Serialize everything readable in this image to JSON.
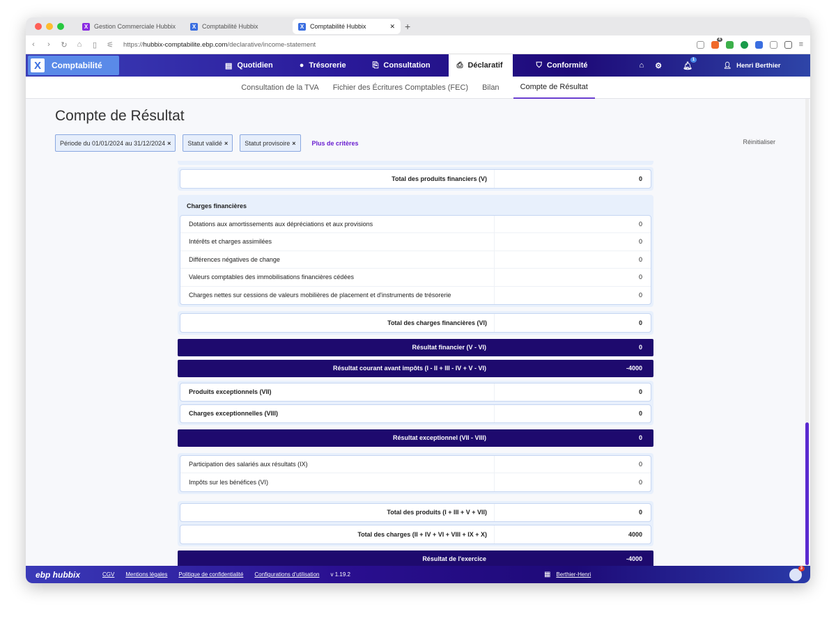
{
  "browser": {
    "tabs": [
      {
        "label": "Gestion Commerciale Hubbix",
        "color": "#8a2be2"
      },
      {
        "label": "Comptabilité Hubbix",
        "color": "#3a6ee0"
      },
      {
        "label": "Comptabilité Hubbix",
        "color": "#3a6ee0",
        "active": true
      }
    ],
    "url_prefix": "https://",
    "url_host": "hubbix-comptabilite.ebp.com",
    "url_path": "/declarative/income-statement",
    "shield_badge": "4"
  },
  "app": {
    "brand": "Comptabilité",
    "menu": [
      {
        "label": "Quotidien",
        "icon": "▤"
      },
      {
        "label": "Trésorerie",
        "icon": "●"
      },
      {
        "label": "Consultation",
        "icon": "⎘"
      },
      {
        "label": "Déclaratif",
        "icon": "⎙",
        "active": true
      },
      {
        "label": "Conformité",
        "icon": "⛉"
      }
    ],
    "notifications": "1",
    "user": "Henri Berthier"
  },
  "subnav": [
    "Consultation de la TVA",
    "Fichier des Écritures Comptables (FEC)",
    "Bilan",
    "Compte de Résultat"
  ],
  "page": {
    "title": "Compte de Résultat",
    "filters": [
      "Période du 01/01/2024 au 31/12/2024",
      "Statut validé",
      "Statut provisoire"
    ],
    "more": "Plus de critères",
    "reset": "Réinitialiser"
  },
  "report": {
    "total_produits_fin": {
      "label": "Total des produits financiers (V)",
      "value": "0"
    },
    "charges_fin": {
      "header": "Charges financières",
      "rows": [
        {
          "label": "Dotations aux amortissements aux dépréciations et aux provisions",
          "value": "0"
        },
        {
          "label": "Intérêts et charges assimilées",
          "value": "0"
        },
        {
          "label": "Différences négatives de change",
          "value": "0"
        },
        {
          "label": "Valeurs comptables des immobilisations financières cédées",
          "value": "0"
        },
        {
          "label": "Charges nettes sur cessions de valeurs mobilières de placement et d'instruments de trésorerie",
          "value": "0"
        }
      ]
    },
    "total_charges_fin": {
      "label": "Total des charges financières (VI)",
      "value": "0"
    },
    "resultat_fin": {
      "label": "Résultat financier (V - VI)",
      "value": "0"
    },
    "resultat_courant": {
      "label": "Résultat courant avant impôts (I - II + III - IV + V - VI)",
      "value": "-4000"
    },
    "exceptionnels": [
      {
        "label": "Produits exceptionnels (VII)",
        "value": "0"
      },
      {
        "label": "Charges exceptionnelles (VIII)",
        "value": "0"
      }
    ],
    "resultat_exc": {
      "label": "Résultat exceptionnel (VII - VIII)",
      "value": "0"
    },
    "participation": [
      {
        "label": "Participation des salariés aux résultats (IX)",
        "value": "0"
      },
      {
        "label": "Impôts sur les bénéfices (VI)",
        "value": "0"
      }
    ],
    "totaux": [
      {
        "label": "Total des produits (I + III + V + VII)",
        "value": "0"
      },
      {
        "label": "Total des charges (II + IV + VI + VIII + IX + X)",
        "value": "4000"
      }
    ],
    "resultat_exercice": {
      "label": "Résultat de l'exercice",
      "value": "-4000"
    }
  },
  "footer": {
    "logo": "ebp hubbix",
    "links": [
      "CGV",
      "Mentions légales",
      "Politique de confidentialité",
      "Configurations d'utilisation"
    ],
    "version": "v 1.19.2",
    "company": "Berthier-Henri",
    "chat_badge": "3"
  }
}
